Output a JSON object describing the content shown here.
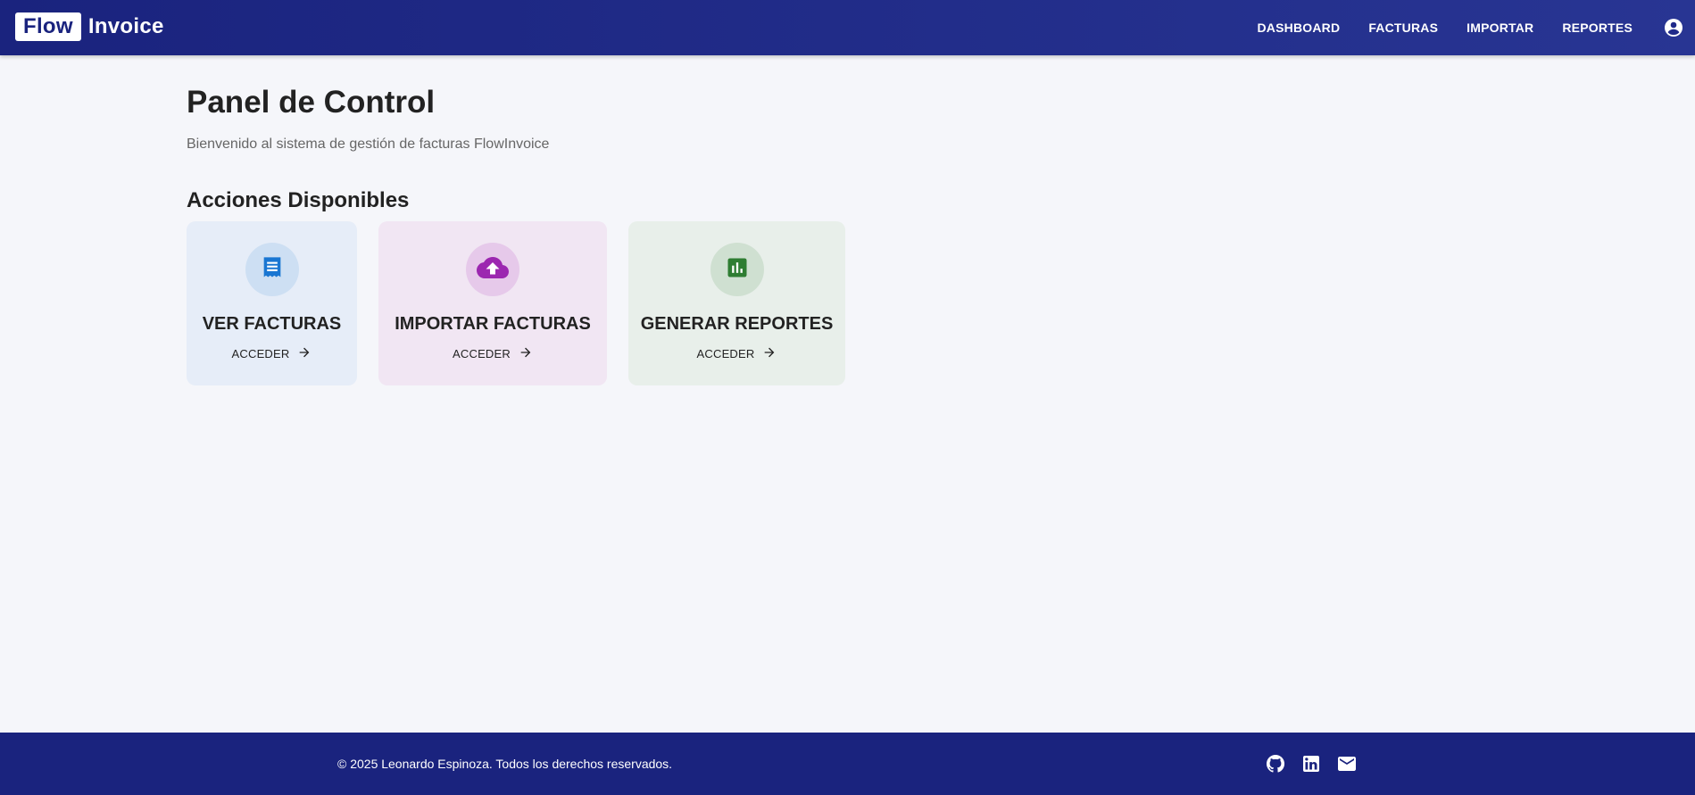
{
  "header": {
    "brand_box": "Flow",
    "brand_text": "Invoice",
    "nav": [
      "DASHBOARD",
      "FACTURAS",
      "IMPORTAR",
      "REPORTES"
    ],
    "account_icon": "account-circle-icon"
  },
  "main": {
    "title": "Panel de Control",
    "subtitle": "Bienvenido al sistema de gestión de facturas FlowInvoice",
    "section_title": "Acciones Disponibles",
    "cards": [
      {
        "title": "VER FACTURAS",
        "action": "ACCEDER",
        "icon": "receipt-icon",
        "color": "#1976d2"
      },
      {
        "title": "IMPORTAR FACTURAS",
        "action": "ACCEDER",
        "icon": "cloud-upload-icon",
        "color": "#9c27b0"
      },
      {
        "title": "GENERAR REPORTES",
        "action": "ACCEDER",
        "icon": "bar-chart-icon",
        "color": "#2e7d32"
      }
    ]
  },
  "footer": {
    "copyright": "© 2025 Leonardo Espinoza. Todos los derechos reservados.",
    "social": [
      "github-icon",
      "linkedin-icon",
      "mail-icon"
    ]
  },
  "colors": {
    "primary": "#1a237e",
    "background": "#f5f6fa"
  }
}
